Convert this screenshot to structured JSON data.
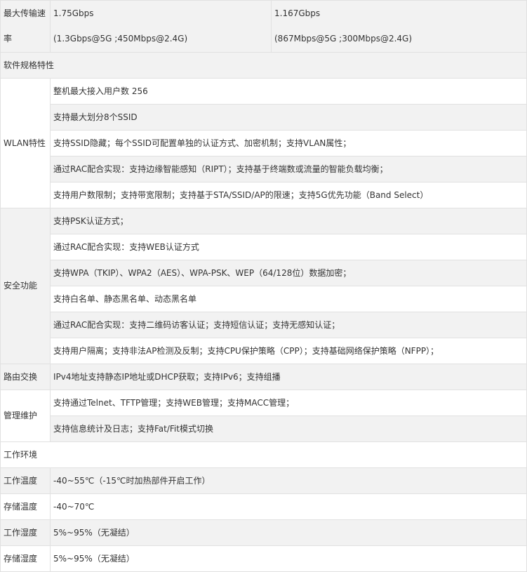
{
  "speed": {
    "label": "最大传输速率",
    "label_l1": "最大传输速",
    "label_l2": "率",
    "a_l1": "1.75Gbps",
    "a_l2": "(1.3Gbps@5G ;450Mbps@2.4G)",
    "b_l1": "1.167Gbps",
    "b_l2": "(867Mbps@5G ;300Mbps@2.4G)"
  },
  "software_section": "软件规格特性",
  "wlan": {
    "label": "WLAN特性",
    "items": [
      "整机最大接入用户数 256",
      "支持最大划分8个SSID",
      "支持SSID隐藏；每个SSID可配置单独的认证方式、加密机制；支持VLAN属性；",
      "通过RAC配合实现：支持边缘智能感知（RIPT）；支持基于终端数或流量的智能负载均衡；",
      "支持用户数限制；支持带宽限制；支持基于STA/SSID/AP的限速；支持5G优先功能（Band Select）"
    ]
  },
  "security": {
    "label": "安全功能",
    "items": [
      "支持PSK认证方式；",
      "通过RAC配合实现：支持WEB认证方式",
      "支持WPA（TKIP）、WPA2（AES）、WPA-PSK、WEP（64/128位）数据加密；",
      "支持白名单、静态黑名单、动态黑名单",
      "通过RAC配合实现：支持二维码访客认证；支持短信认证；支持无感知认证；",
      "支持用户隔离；支持非法AP检测及反制；支持CPU保护策略（CPP）；支持基础网络保护策略（NFPP）；"
    ]
  },
  "routing": {
    "label": "路由交换",
    "value": "IPv4地址支持静态IP地址或DHCP获取；支持IPv6；支持组播"
  },
  "management": {
    "label": "管理维护",
    "items": [
      "支持通过Telnet、TFTP管理；支持WEB管理；支持MACC管理；",
      "支持信息统计及日志；支持Fat/Fit模式切换"
    ]
  },
  "environment_section": "工作环境",
  "environment": [
    {
      "label": "工作温度",
      "value": "-40~55℃（-15℃时加热部件开启工作）"
    },
    {
      "label": "存储温度",
      "value": "-40~70℃"
    },
    {
      "label": "工作湿度",
      "value": "5%~95%（无凝结）"
    },
    {
      "label": "存储湿度",
      "value": "5%~95%（无凝结）"
    }
  ]
}
